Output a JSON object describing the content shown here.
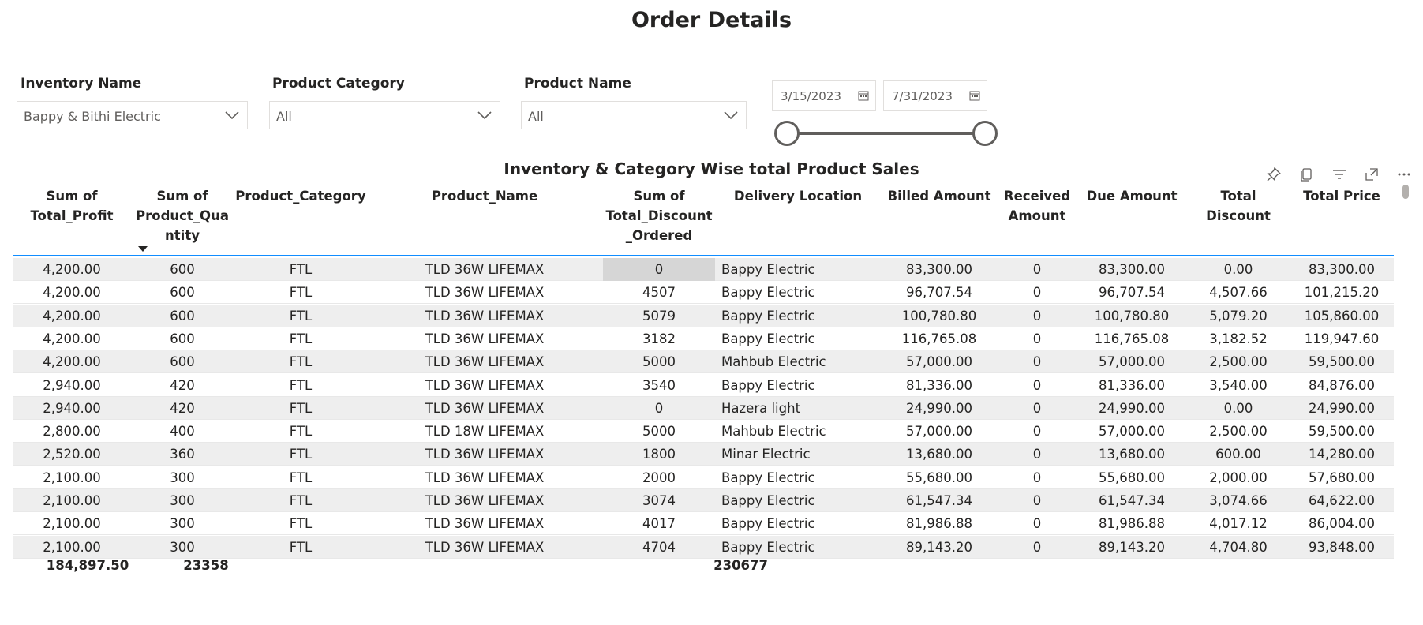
{
  "page_title": "Order Details",
  "filters": {
    "inventory": {
      "label": "Inventory Name",
      "value": "Bappy & Bithi Electric"
    },
    "category": {
      "label": "Product Category",
      "value": "All"
    },
    "product": {
      "label": "Product Name",
      "value": "All"
    },
    "date_start": "3/15/2023",
    "date_end": "7/31/2023"
  },
  "visual": {
    "title": "Inventory & Category Wise total Product Sales",
    "icons": [
      "pin-icon",
      "copy-icon",
      "filter-icon",
      "focus-mode-icon",
      "more-options-icon"
    ]
  },
  "columns": [
    {
      "key": "profit",
      "label_lines": [
        "Sum of",
        "Total_Profit"
      ]
    },
    {
      "key": "qty",
      "label_lines": [
        "Sum of",
        "Product_Qua",
        "ntity"
      ]
    },
    {
      "key": "category",
      "label_lines": [
        "Product_Category"
      ]
    },
    {
      "key": "name",
      "label_lines": [
        "Product_Name"
      ]
    },
    {
      "key": "disc_ordered",
      "label_lines": [
        "Sum of",
        "Total_Discount",
        "_Ordered"
      ]
    },
    {
      "key": "location",
      "label_lines": [
        "Delivery Location"
      ]
    },
    {
      "key": "billed",
      "label_lines": [
        "Billed Amount"
      ]
    },
    {
      "key": "received",
      "label_lines": [
        "Received",
        "Amount"
      ]
    },
    {
      "key": "due",
      "label_lines": [
        "Due Amount"
      ]
    },
    {
      "key": "discount",
      "label_lines": [
        "Total Discount"
      ]
    },
    {
      "key": "price",
      "label_lines": [
        "Total Price"
      ]
    }
  ],
  "rows": [
    [
      "4,200.00",
      "600",
      "FTL",
      "TLD 36W LIFEMAX",
      "0",
      "Bappy Electric",
      "83,300.00",
      "0",
      "83,300.00",
      "0.00",
      "83,300.00"
    ],
    [
      "4,200.00",
      "600",
      "FTL",
      "TLD 36W LIFEMAX",
      "4507",
      "Bappy Electric",
      "96,707.54",
      "0",
      "96,707.54",
      "4,507.66",
      "101,215.20"
    ],
    [
      "4,200.00",
      "600",
      "FTL",
      "TLD 36W LIFEMAX",
      "5079",
      "Bappy Electric",
      "100,780.80",
      "0",
      "100,780.80",
      "5,079.20",
      "105,860.00"
    ],
    [
      "4,200.00",
      "600",
      "FTL",
      "TLD 36W LIFEMAX",
      "3182",
      "Bappy Electric",
      "116,765.08",
      "0",
      "116,765.08",
      "3,182.52",
      "119,947.60"
    ],
    [
      "4,200.00",
      "600",
      "FTL",
      "TLD 36W LIFEMAX",
      "5000",
      "Mahbub Electric",
      "57,000.00",
      "0",
      "57,000.00",
      "2,500.00",
      "59,500.00"
    ],
    [
      "2,940.00",
      "420",
      "FTL",
      "TLD 36W LIFEMAX",
      "3540",
      "Bappy Electric",
      "81,336.00",
      "0",
      "81,336.00",
      "3,540.00",
      "84,876.00"
    ],
    [
      "2,940.00",
      "420",
      "FTL",
      "TLD 36W LIFEMAX",
      "0",
      "Hazera light",
      "24,990.00",
      "0",
      "24,990.00",
      "0.00",
      "24,990.00"
    ],
    [
      "2,800.00",
      "400",
      "FTL",
      "TLD 18W LIFEMAX",
      "5000",
      "Mahbub Electric",
      "57,000.00",
      "0",
      "57,000.00",
      "2,500.00",
      "59,500.00"
    ],
    [
      "2,520.00",
      "360",
      "FTL",
      "TLD 36W LIFEMAX",
      "1800",
      "Minar Electric",
      "13,680.00",
      "0",
      "13,680.00",
      "600.00",
      "14,280.00"
    ],
    [
      "2,100.00",
      "300",
      "FTL",
      "TLD 36W LIFEMAX",
      "2000",
      "Bappy Electric",
      "55,680.00",
      "0",
      "55,680.00",
      "2,000.00",
      "57,680.00"
    ],
    [
      "2,100.00",
      "300",
      "FTL",
      "TLD 36W LIFEMAX",
      "3074",
      "Bappy Electric",
      "61,547.34",
      "0",
      "61,547.34",
      "3,074.66",
      "64,622.00"
    ],
    [
      "2,100.00",
      "300",
      "FTL",
      "TLD 36W LIFEMAX",
      "4017",
      "Bappy Electric",
      "81,986.88",
      "0",
      "81,986.88",
      "4,017.12",
      "86,004.00"
    ],
    [
      "2,100.00",
      "300",
      "FTL",
      "TLD 36W LIFEMAX",
      "4704",
      "Bappy Electric",
      "89,143.20",
      "0",
      "89,143.20",
      "4,704.80",
      "93,848.00"
    ]
  ],
  "totals": {
    "profit": "184,897.50",
    "qty": "23358",
    "disc_ordered": "230677"
  }
}
